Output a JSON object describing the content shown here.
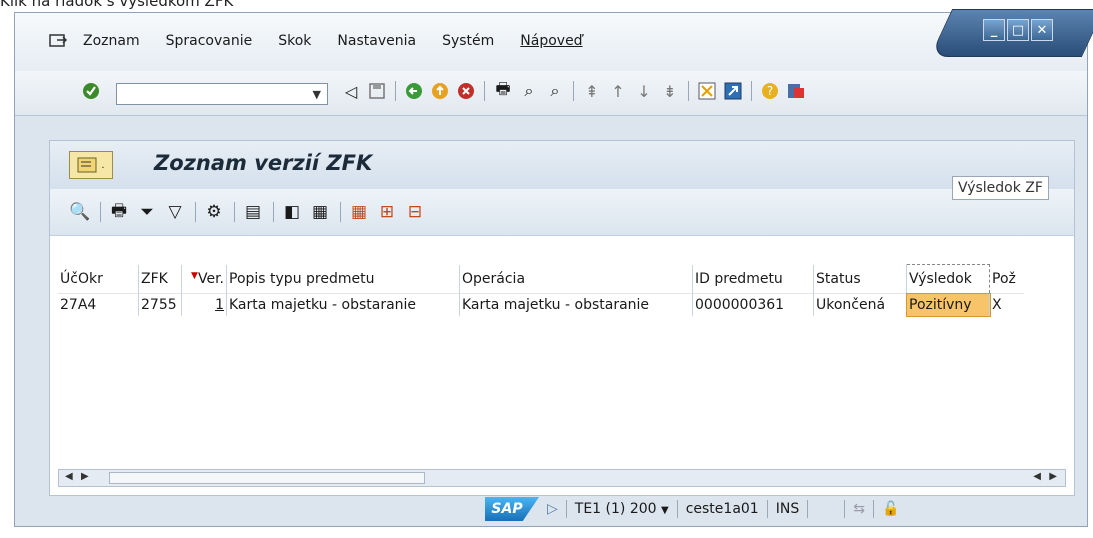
{
  "caption": "Klik na riadok s výsledkom ZFK",
  "menu": [
    "Zoznam",
    "Spracovanie",
    "Skok",
    "Nastavenia",
    "Systém",
    "Nápoveď"
  ],
  "window_controls": [
    "minimize",
    "maximize",
    "close"
  ],
  "toolbar": {
    "command_field": "",
    "icons": [
      "enter-icon",
      "back-icon",
      "save-icon",
      "back-arrow-icon",
      "exit-icon",
      "cancel-icon",
      "print-icon",
      "find-icon",
      "find-next-icon",
      "first-page-icon",
      "prev-page-icon",
      "next-page-icon",
      "last-page-icon",
      "create-session-icon",
      "shortcut-icon",
      "help-icon",
      "customize-icon"
    ]
  },
  "main": {
    "title": "Zoznam verzií ZFK",
    "alv_icons": [
      "details-icon",
      "print-icon",
      "sort-asc-icon",
      "filter-icon",
      "sum-icon",
      "export-icon",
      "excel-icon",
      "word-icon",
      "layout-icon",
      "layout-change-icon",
      "layout-save-icon"
    ]
  },
  "table": {
    "columns": [
      "ÚčOkr",
      "ZFK",
      "Ver.",
      "Popis typu predmetu",
      "Operácia",
      "ID predmetu",
      "Status",
      "Výsledok",
      "Pož"
    ],
    "rows": [
      [
        "27A4",
        "2755",
        "1",
        "Karta majetku - obstaranie",
        "Karta majetku - obstaranie",
        "0000000361",
        "Ukončená",
        "Pozitívny",
        "X"
      ]
    ]
  },
  "tooltip": "Výsledok ZF",
  "status": {
    "sap": "SAP",
    "system": "TE1 (1) 200",
    "server": "ceste1a01",
    "mode": "INS"
  }
}
